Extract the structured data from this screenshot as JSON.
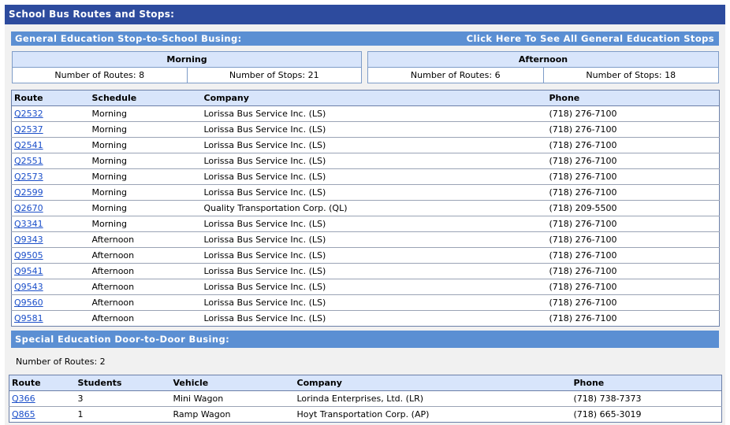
{
  "page_title": "School Bus Routes and Stops:",
  "general": {
    "title": "General Education Stop-to-School Busing:",
    "link_label": "Click Here To See All General Education Stops",
    "morning": {
      "label": "Morning",
      "routes": "Number of Routes: 8",
      "stops": "Number of Stops: 21"
    },
    "afternoon": {
      "label": "Afternoon",
      "routes": "Number of Routes: 6",
      "stops": "Number of Stops: 18"
    },
    "columns": [
      "Route",
      "Schedule",
      "Company",
      "Phone"
    ],
    "rows": [
      {
        "route": "Q2532",
        "schedule": "Morning",
        "company": "Lorissa Bus Service Inc. (LS)",
        "phone": "(718) 276-7100"
      },
      {
        "route": "Q2537",
        "schedule": "Morning",
        "company": "Lorissa Bus Service Inc. (LS)",
        "phone": "(718) 276-7100"
      },
      {
        "route": "Q2541",
        "schedule": "Morning",
        "company": "Lorissa Bus Service Inc. (LS)",
        "phone": "(718) 276-7100"
      },
      {
        "route": "Q2551",
        "schedule": "Morning",
        "company": "Lorissa Bus Service Inc. (LS)",
        "phone": "(718) 276-7100"
      },
      {
        "route": "Q2573",
        "schedule": "Morning",
        "company": "Lorissa Bus Service Inc. (LS)",
        "phone": "(718) 276-7100"
      },
      {
        "route": "Q2599",
        "schedule": "Morning",
        "company": "Lorissa Bus Service Inc. (LS)",
        "phone": "(718) 276-7100"
      },
      {
        "route": "Q2670",
        "schedule": "Morning",
        "company": "Quality Transportation Corp. (QL)",
        "phone": "(718) 209-5500"
      },
      {
        "route": "Q3341",
        "schedule": "Morning",
        "company": "Lorissa Bus Service Inc. (LS)",
        "phone": "(718) 276-7100"
      },
      {
        "route": "Q9343",
        "schedule": "Afternoon",
        "company": "Lorissa Bus Service Inc. (LS)",
        "phone": "(718) 276-7100"
      },
      {
        "route": "Q9505",
        "schedule": "Afternoon",
        "company": "Lorissa Bus Service Inc. (LS)",
        "phone": "(718) 276-7100"
      },
      {
        "route": "Q9541",
        "schedule": "Afternoon",
        "company": "Lorissa Bus Service Inc. (LS)",
        "phone": "(718) 276-7100"
      },
      {
        "route": "Q9543",
        "schedule": "Afternoon",
        "company": "Lorissa Bus Service Inc. (LS)",
        "phone": "(718) 276-7100"
      },
      {
        "route": "Q9560",
        "schedule": "Afternoon",
        "company": "Lorissa Bus Service Inc. (LS)",
        "phone": "(718) 276-7100"
      },
      {
        "route": "Q9581",
        "schedule": "Afternoon",
        "company": "Lorissa Bus Service Inc. (LS)",
        "phone": "(718) 276-7100"
      }
    ]
  },
  "special": {
    "title": "Special Education Door-to-Door Busing:",
    "routes_count": "Number of Routes: 2",
    "columns": [
      "Route",
      "Students",
      "Vehicle",
      "Company",
      "Phone"
    ],
    "rows": [
      {
        "route": "Q366",
        "students": "3",
        "vehicle": "Mini Wagon",
        "company": "Lorinda Enterprises, Ltd. (LR)",
        "phone": "(718) 738-7373"
      },
      {
        "route": "Q865",
        "students": "1",
        "vehicle": "Ramp Wagon",
        "company": "Hoyt Transportation Corp. (AP)",
        "phone": "(718) 665-3019"
      }
    ]
  },
  "colors": {
    "title_bar": "#2d4b9e",
    "section_bar": "#5b8fd3",
    "header_bg": "#d8e5fb",
    "link": "#1a4ec9"
  }
}
